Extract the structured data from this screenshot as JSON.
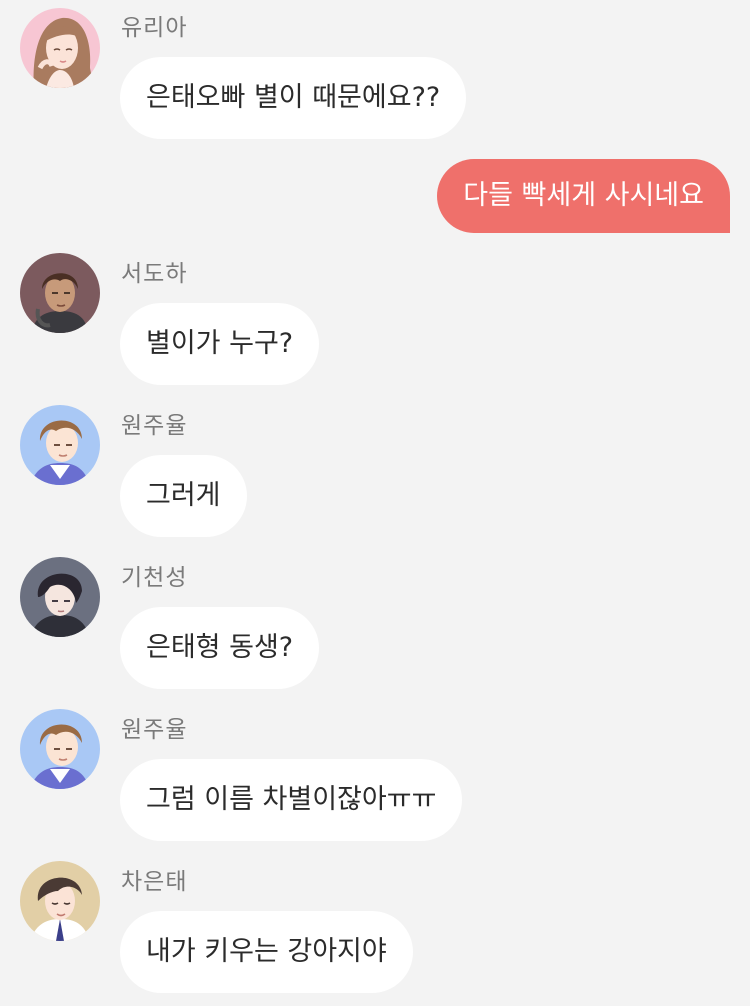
{
  "chat": {
    "messages": [
      {
        "sender": "유리아",
        "text": "은태오빠 별이 때문에요??",
        "avatar": "yuria-avatar",
        "direction": "incoming"
      },
      {
        "sender": "",
        "text": "다들 빡세게 사시네요",
        "direction": "outgoing"
      },
      {
        "sender": "서도하",
        "text": "별이가 누구?",
        "avatar": "doha-avatar",
        "direction": "incoming"
      },
      {
        "sender": "원주율",
        "text": "그러게",
        "avatar": "juyul-avatar",
        "direction": "incoming"
      },
      {
        "sender": "기천성",
        "text": "은태형 동생?",
        "avatar": "cheonseong-avatar",
        "direction": "incoming"
      },
      {
        "sender": "원주율",
        "text": "그럼 이름 차별이잖아ㅠㅠ",
        "avatar": "juyul-avatar",
        "direction": "incoming"
      },
      {
        "sender": "차은태",
        "text": "내가 키우는 강아지야",
        "avatar": "euntae-avatar",
        "direction": "incoming"
      }
    ]
  },
  "colors": {
    "background": "#f3f3f3",
    "incoming_bubble": "#ffffff",
    "outgoing_bubble": "#ef706b",
    "sender_name": "#7a7a7a",
    "message_text": "#2b2b2b"
  }
}
